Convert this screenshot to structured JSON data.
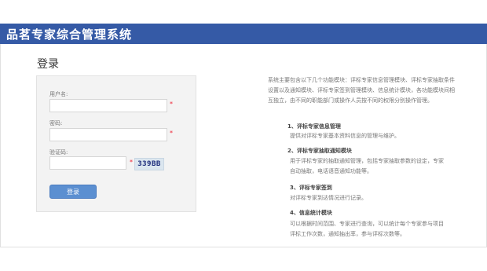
{
  "header": {
    "title": "品茗专家综合管理系统"
  },
  "login": {
    "title": "登录",
    "username_label": "用户名:",
    "password_label": "密码:",
    "captcha_label": "验证码:",
    "required_mark": "*",
    "captcha_code": "339BB",
    "submit_label": "登录"
  },
  "description": {
    "intro": "系统主要包含以下几个功能模块：评标专家信息管理模块、评标专家抽取条件设置以及通知模块、评标专家签到管理模块、信息统计模块，各功能模块间相互独立，由不同的职能部门或操作人员按不同的权限分别操作管理。",
    "modules": [
      {
        "title": "1、评标专家信息管理",
        "desc": [
          "提供对评标专家基本资料信息的管理与维护。"
        ]
      },
      {
        "title": "2、评标专家抽取通知模块",
        "desc": [
          "用于评标专家的抽取通知管理，包括专家抽取参数的设定，专家",
          "自动抽取，电话语音通知功能等。"
        ]
      },
      {
        "title": "3、评标专家签到",
        "desc": [
          "对评标专家到达情况进行记录。"
        ]
      },
      {
        "title": "4、信息统计模块",
        "desc": [
          "可以根据时间范围、专家进行查询，可以统计每个专家参与项目",
          "评标工作次数，通知抽出率，参与评标次数等。"
        ]
      }
    ]
  }
}
